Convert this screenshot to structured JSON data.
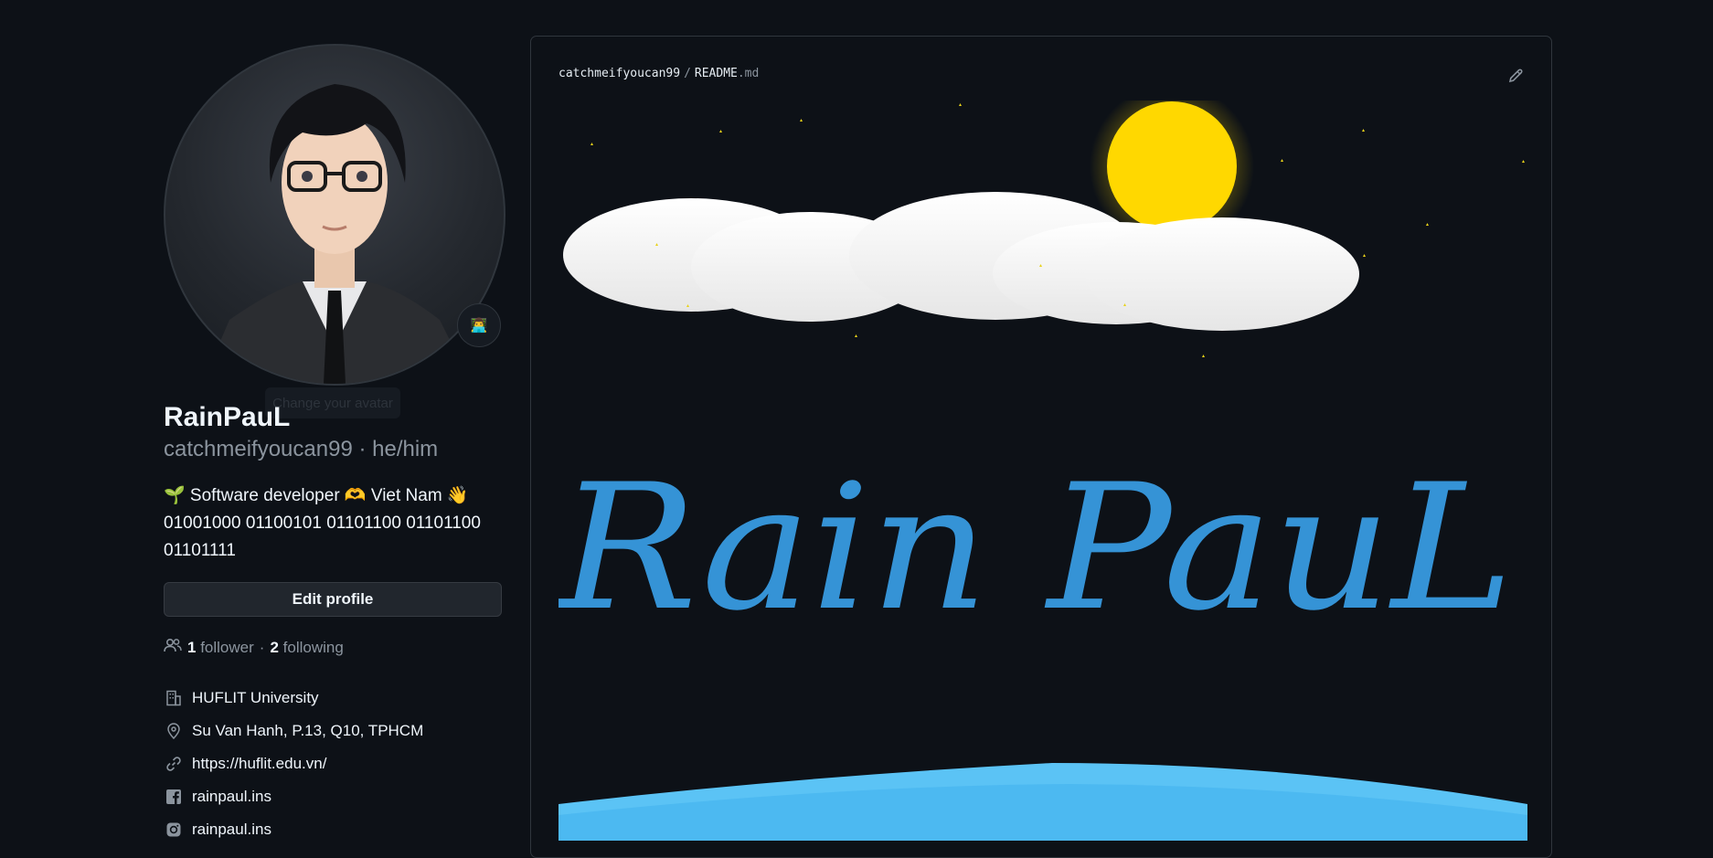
{
  "profile": {
    "avatar_tooltip": "Change your avatar",
    "name": "RainPauL",
    "login": "catchmeifyoucan99",
    "pronouns_sep": " · ",
    "pronouns": "he/him",
    "bio_line1": "🌱 Software developer 🫶 Viet Nam 👋",
    "bio_line2": "01001000 01100101 01101100 01101100",
    "bio_line3": "01101111",
    "edit_button": "Edit profile",
    "followers_count": "1",
    "followers_label": "follower",
    "dot": "·",
    "following_count": "2",
    "following_label": "following",
    "details": [
      {
        "icon": "organization-icon",
        "text": "HUFLIT University"
      },
      {
        "icon": "location-icon",
        "text": "Su Van Hanh, P.13, Q10, TPHCM"
      },
      {
        "icon": "link-icon",
        "text": "https://huflit.edu.vn/"
      },
      {
        "icon": "facebook-icon",
        "text": "rainpaul.ins"
      },
      {
        "icon": "instagram-icon",
        "text": "rainpaul.ins"
      }
    ]
  },
  "readme": {
    "repo": "catchmeifyoucan99",
    "separator": "/",
    "file_name": "README",
    "file_ext": ".md",
    "banner_text": "Rain PauL"
  },
  "colors": {
    "background": "#0d1117",
    "banner_text": "#3593d6",
    "sun": "#ffd800",
    "wave": "#5bc3f5"
  }
}
